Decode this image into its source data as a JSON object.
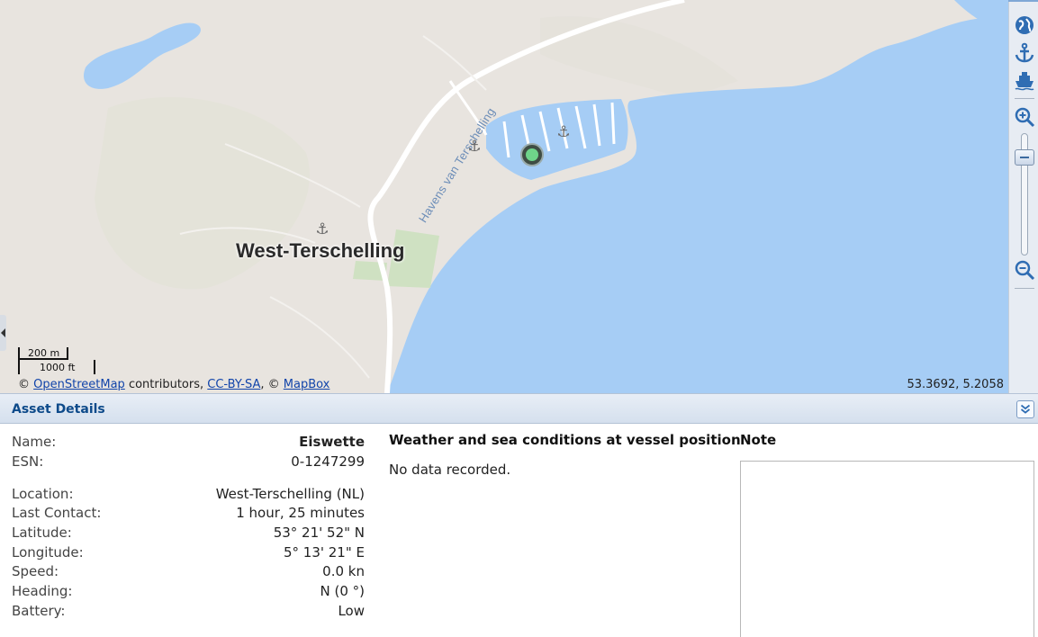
{
  "map": {
    "town_label": "West-Terschelling",
    "harbour_label": "Havens van Terschelling",
    "scale": {
      "metric": "200 m",
      "imperial": "1000 ft"
    },
    "attribution": {
      "prefix": "©",
      "osm_link": "OpenStreetMap",
      "contributors": "contributors,",
      "license_link": "CC-BY-SA",
      "separator": ", ©",
      "mapbox_link": "MapBox"
    },
    "coordinates": "53.3692, 5.2058",
    "colors": {
      "water": "#a6cdf5",
      "land": "#e8e4df",
      "park": "#cfe1c2",
      "vessel": "#6fd48a"
    }
  },
  "toolbar": {
    "icons": [
      "globe-icon",
      "anchor-icon",
      "ship-icon",
      "zoom-in-icon",
      "zoom-out-icon"
    ],
    "zoom_level": 0.85
  },
  "panel": {
    "title": "Asset Details",
    "fields": {
      "name": {
        "label": "Name:",
        "value": "Eiswette"
      },
      "esn": {
        "label": "ESN:",
        "value": "0-1247299"
      },
      "location": {
        "label": "Location:",
        "value": "West-Terschelling (NL)"
      },
      "last_contact": {
        "label": "Last Contact:",
        "value": "1 hour, 25 minutes"
      },
      "latitude": {
        "label": "Latitude:",
        "value": "53° 21' 52\" N"
      },
      "longitude": {
        "label": "Longitude:",
        "value": "5° 13' 21\" E"
      },
      "speed": {
        "label": "Speed:",
        "value": "0.0 kn"
      },
      "heading": {
        "label": "Heading:",
        "value": "N (0 °)"
      },
      "battery": {
        "label": "Battery:",
        "value": "Low"
      }
    },
    "weather": {
      "title": "Weather and sea conditions at vessel position",
      "text": "No data recorded."
    },
    "note": {
      "title": "Note",
      "value": ""
    }
  }
}
